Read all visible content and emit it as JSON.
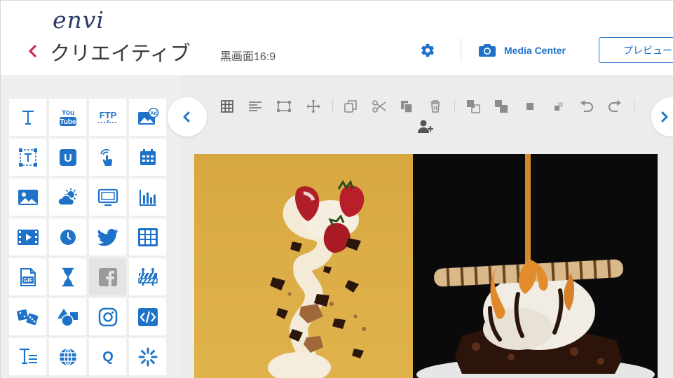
{
  "header": {
    "logo": "envi",
    "title": "クリエイティブ",
    "ratio": "黒画面16:9",
    "media_center": "Media Center",
    "preview": "プレビュー"
  },
  "sidebar": {
    "tiles": [
      {
        "icon": "text-icon"
      },
      {
        "icon": "youtube-icon",
        "label": "You Tube"
      },
      {
        "icon": "ftp-icon",
        "label": "FTP"
      },
      {
        "icon": "image-ad-icon",
        "label": "Ad"
      },
      {
        "icon": "text-box-icon"
      },
      {
        "icon": "u-icon",
        "label": "U"
      },
      {
        "icon": "touch-icon"
      },
      {
        "icon": "calendar-icon"
      },
      {
        "icon": "image-icon"
      },
      {
        "icon": "weather-icon"
      },
      {
        "icon": "tv-icon"
      },
      {
        "icon": "bar-chart-icon"
      },
      {
        "icon": "video-icon"
      },
      {
        "icon": "clock-icon"
      },
      {
        "icon": "twitter-icon"
      },
      {
        "icon": "table-icon"
      },
      {
        "icon": "gif-icon",
        "label": "GIF"
      },
      {
        "icon": "hourglass-icon"
      },
      {
        "icon": "facebook-icon"
      },
      {
        "icon": "roadblock-icon"
      },
      {
        "icon": "dice-icon"
      },
      {
        "icon": "shapes-icon"
      },
      {
        "icon": "instagram-icon"
      },
      {
        "icon": "code-icon"
      },
      {
        "icon": "text-lines-icon"
      },
      {
        "icon": "globe-icon"
      },
      {
        "icon": "q-icon",
        "label": "Q"
      },
      {
        "icon": "loading-icon"
      }
    ]
  },
  "toolbar": {
    "items": [
      "grid-icon",
      "align-icon",
      "fit-frame-icon",
      "move-icon",
      "copy-icon",
      "cut-icon",
      "paste-icon",
      "delete-icon",
      "bring-front-icon",
      "send-back-icon",
      "forward-icon",
      "backward-icon",
      "undo-icon",
      "redo-icon",
      "add-user-icon"
    ]
  },
  "colors": {
    "accent": "#1e73c8",
    "back_arrow": "#d0294f",
    "logo": "#2b3a67",
    "icon_gray": "#8c8c8c"
  }
}
